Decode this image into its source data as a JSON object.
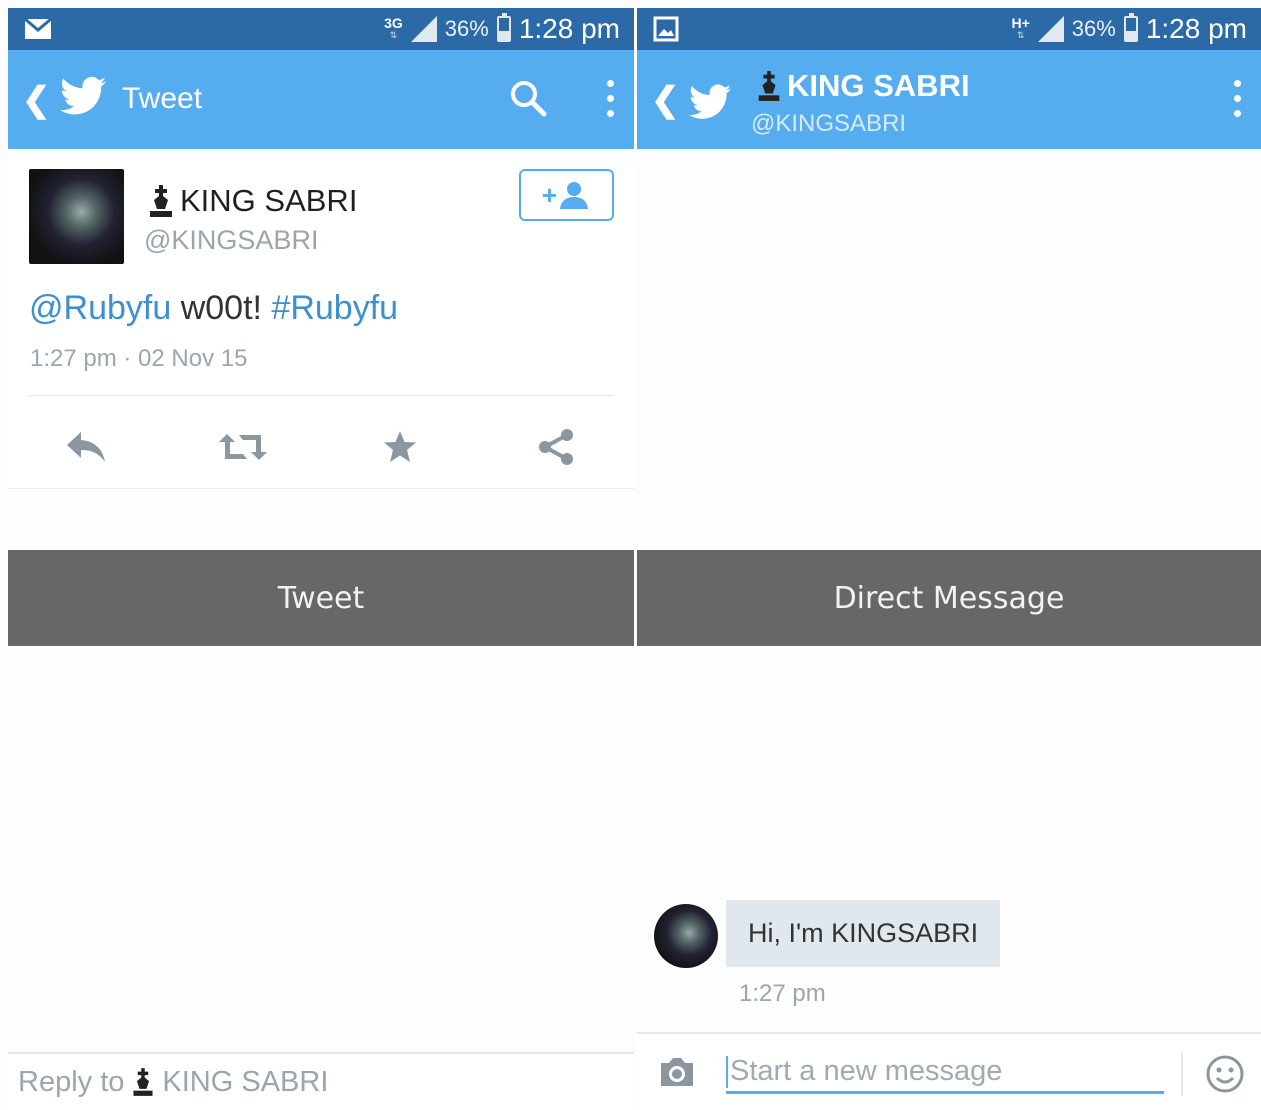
{
  "left": {
    "status": {
      "network": "3G",
      "battery": "36%",
      "time": "1:28 pm"
    },
    "appbar": {
      "title": "Tweet"
    },
    "tweet": {
      "name": "KING SABRI",
      "handle": "@KINGSABRI",
      "mention": "@Rubyfu",
      "text_mid": " w00t! ",
      "hashtag": "#Rubyfu",
      "timestamp": "1:27 pm · 02 Nov 15",
      "follow_label": "+"
    },
    "banner": "Tweet",
    "reply": {
      "prefix": "Reply to",
      "name": "KING SABRI"
    }
  },
  "right": {
    "status": {
      "network": "H+",
      "battery": "36%",
      "time": "1:28 pm"
    },
    "appbar": {
      "name": "KING SABRI",
      "handle": "@KINGSABRI"
    },
    "banner": "Direct Message",
    "message": {
      "text": "Hi, I'm KINGSABRI",
      "time": "1:27 pm"
    },
    "composer": {
      "placeholder": "Start a new message"
    }
  },
  "colors": {
    "brand": "#55acee",
    "status_bar": "#2b6aa6",
    "banner": "#676767",
    "link": "#3d8fcf"
  },
  "icons": [
    "mail-icon",
    "gallery-icon",
    "signal-icon",
    "battery-icon",
    "back-icon",
    "twitter-bird-icon",
    "search-icon",
    "overflow-menu-icon",
    "follow-icon",
    "reply-icon",
    "retweet-icon",
    "favorite-icon",
    "share-icon",
    "chess-king-icon",
    "camera-icon",
    "emoji-icon"
  ]
}
